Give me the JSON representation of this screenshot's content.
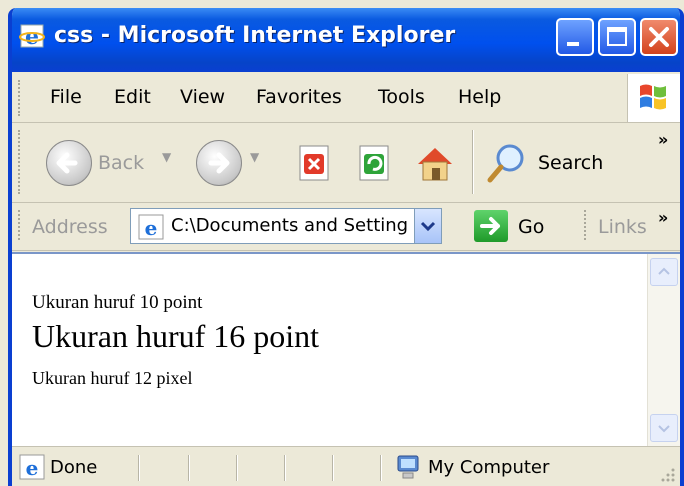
{
  "window": {
    "title": "css - Microsoft Internet Explorer"
  },
  "menubar": {
    "items": [
      "File",
      "Edit",
      "View",
      "Favorites",
      "Tools",
      "Help"
    ]
  },
  "toolbar": {
    "back_label": "Back",
    "search_label": "Search",
    "chevron": "»"
  },
  "addressbar": {
    "label": "Address",
    "value": "C:\\Documents and Setting",
    "go_label": "Go",
    "links_label": "Links",
    "chevron": "»"
  },
  "content": {
    "lines": [
      "Ukuran huruf 10 point",
      "Ukuran huruf 16 point",
      "Ukuran huruf 12 pixel"
    ]
  },
  "statusbar": {
    "status": "Done",
    "zone": "My Computer"
  },
  "colors": {
    "titlebar": "#0050ee",
    "close_button": "#d3421c",
    "go_button": "#1f9a2a",
    "page_background": "#ffffff"
  }
}
